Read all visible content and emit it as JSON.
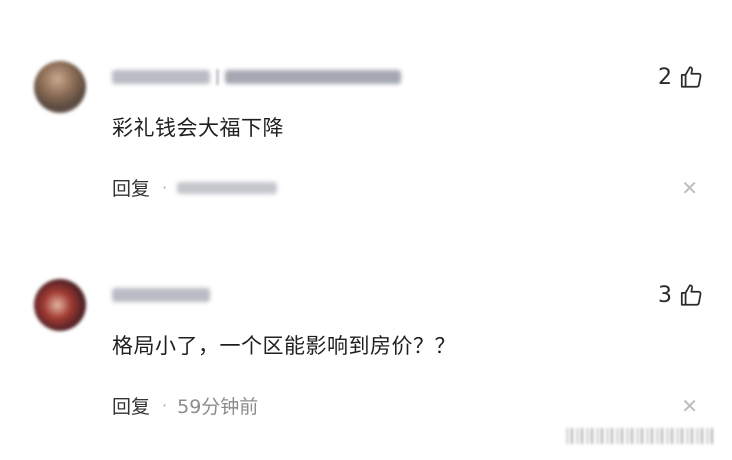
{
  "comments": [
    {
      "text": "彩礼钱会大福下降",
      "reply_label": "回复",
      "separator": "·",
      "time": "",
      "like_count": "2"
    },
    {
      "text": "格局小了，一个区能影响到房价？？",
      "reply_label": "回复",
      "separator": "·",
      "time": "59分钟前",
      "like_count": "3"
    }
  ],
  "icons": {
    "like": "thumbs-up-icon",
    "close": "close-icon"
  },
  "colors": {
    "text": "#1f1f1f",
    "meta": "#8c8c8c",
    "close": "#bdbdbd"
  }
}
